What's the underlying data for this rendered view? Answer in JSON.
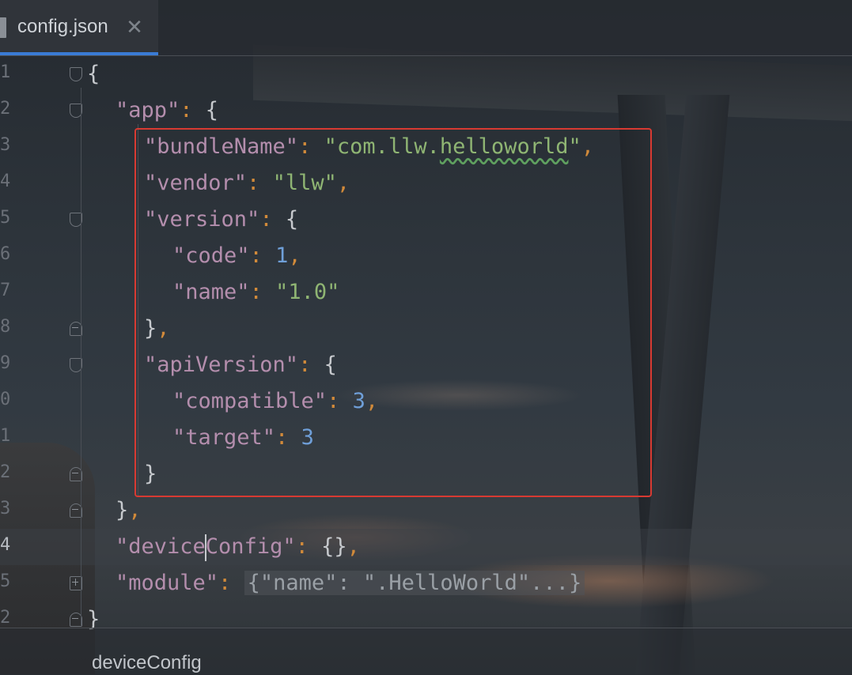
{
  "tab": {
    "label": "config.json",
    "close": "✕"
  },
  "gutter": [
    "1",
    "2",
    "3",
    "4",
    "5",
    "6",
    "7",
    "8",
    "9",
    "0",
    "1",
    "2",
    "3",
    "4",
    "5",
    "2"
  ],
  "lines": {
    "l1_open": "{",
    "l2_key": "\"app\"",
    "l2_colon": ": ",
    "l2_brace": "{",
    "l3_key": "\"bundleName\"",
    "l3_colon": ": ",
    "l3_val_a": "\"com.llw.",
    "l3_val_b": "helloworld",
    "l3_val_c": "\"",
    "l3_comma": ",",
    "l4_key": "\"vendor\"",
    "l4_colon": ": ",
    "l4_val": "\"llw\"",
    "l4_comma": ",",
    "l5_key": "\"version\"",
    "l5_colon": ": ",
    "l5_brace": "{",
    "l6_key": "\"code\"",
    "l6_colon": ": ",
    "l6_val": "1",
    "l6_comma": ",",
    "l7_key": "\"name\"",
    "l7_colon": ": ",
    "l7_val": "\"1.0\"",
    "l8_brace": "}",
    "l8_comma": ",",
    "l9_key": "\"apiVersion\"",
    "l9_colon": ": ",
    "l9_brace": "{",
    "l10_key": "\"compatible\"",
    "l10_colon": ": ",
    "l10_val": "3",
    "l10_comma": ",",
    "l11_key": "\"target\"",
    "l11_colon": ": ",
    "l11_val": "3",
    "l12_brace": "}",
    "l13_brace": "}",
    "l13_comma": ",",
    "l14_key_a": "\"device",
    "l14_key_b": "Config\"",
    "l14_colon": ": ",
    "l14_val": "{}",
    "l14_comma": ",",
    "l15_key": "\"module\"",
    "l15_colon": ": ",
    "l15_collapsed": "{\"name\": \".HelloWorld\"...}",
    "l16_close": "}"
  },
  "breadcrumb": "deviceConfig",
  "colors": {
    "key": "#b48ead",
    "string": "#8fb573",
    "number": "#6f9fd8",
    "punctuation": "#d18a3a",
    "highlight_box": "#d83a32",
    "tab_underline": "#3a7bd5"
  }
}
